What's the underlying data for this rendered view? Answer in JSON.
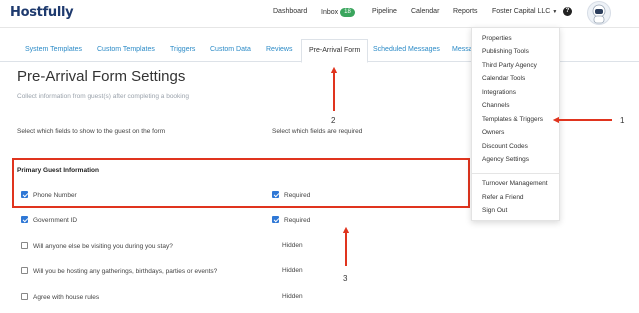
{
  "brand": {
    "name": "Hostfully"
  },
  "topnav": {
    "dashboard": "Dashboard",
    "inbox": "Inbox",
    "inbox_count": "18",
    "pipeline": "Pipeline",
    "calendar": "Calendar",
    "reports": "Reports",
    "account": "Foster Capital LLC",
    "help": "?"
  },
  "tabs": [
    "System Templates",
    "Custom Templates",
    "Triggers",
    "Custom Data",
    "Reviews",
    "Pre-Arrival Form",
    "Scheduled Messages",
    "Messa"
  ],
  "page": {
    "title": "Pre-Arrival Form Settings",
    "subtitle": "Collect information from guest(s) after completing a booking",
    "col_show": "Select which fields to show to the guest on the form",
    "col_required": "Select which fields are required",
    "section": "Primary Guest Information"
  },
  "fields": [
    {
      "label": "Phone Number",
      "show": true,
      "req_label": "Required",
      "required": true
    },
    {
      "label": "Government ID",
      "show": true,
      "req_label": "Required",
      "required": true
    },
    {
      "label": "Will anyone else be visiting you during you stay?",
      "show": false,
      "req_label": "Hidden"
    },
    {
      "label": "Will you be hosting any gatherings, birthdays, parties or events?",
      "show": false,
      "req_label": "Hidden"
    },
    {
      "label": "Agree with house rules",
      "show": false,
      "req_label": "Hidden"
    }
  ],
  "dropdown": {
    "group1": [
      "Properties",
      "Publishing Tools",
      "Third Party Agency",
      "Calendar Tools",
      "Integrations",
      "Channels",
      "Templates & Triggers",
      "Owners",
      "Discount Codes",
      "Agency Settings"
    ],
    "group2": [
      "Turnover Management",
      "Refer a Friend",
      "Sign Out"
    ]
  },
  "annotations": {
    "m1": "1",
    "m2": "2",
    "m3": "3"
  },
  "colors": {
    "accent": "#2c8bc7",
    "highlight": "#e0341e",
    "checkbox": "#2f78d6",
    "badge": "#3aa55d"
  }
}
